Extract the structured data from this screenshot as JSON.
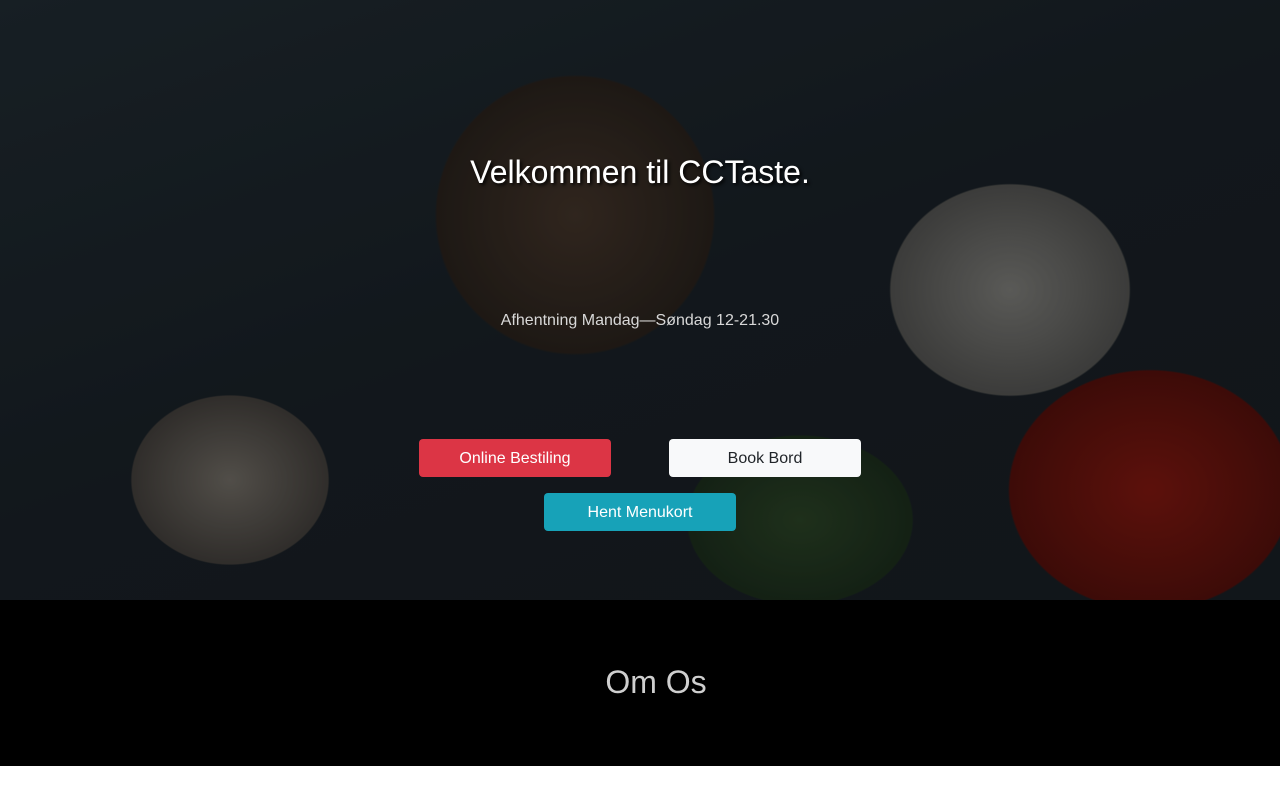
{
  "hero": {
    "title": "Velkommen til CCTaste.",
    "subtitle": "Afhentning Mandag—Søndag 12-21.30",
    "buttons": {
      "online_order": "Online Bestiling",
      "book_table": "Book Bord",
      "menu": "Hent Menukort"
    }
  },
  "about": {
    "title": "Om Os"
  },
  "colors": {
    "red_button": "#dc3545",
    "light_button": "#f8f9fa",
    "teal_button": "#17a2b8",
    "about_background": "#000000"
  }
}
